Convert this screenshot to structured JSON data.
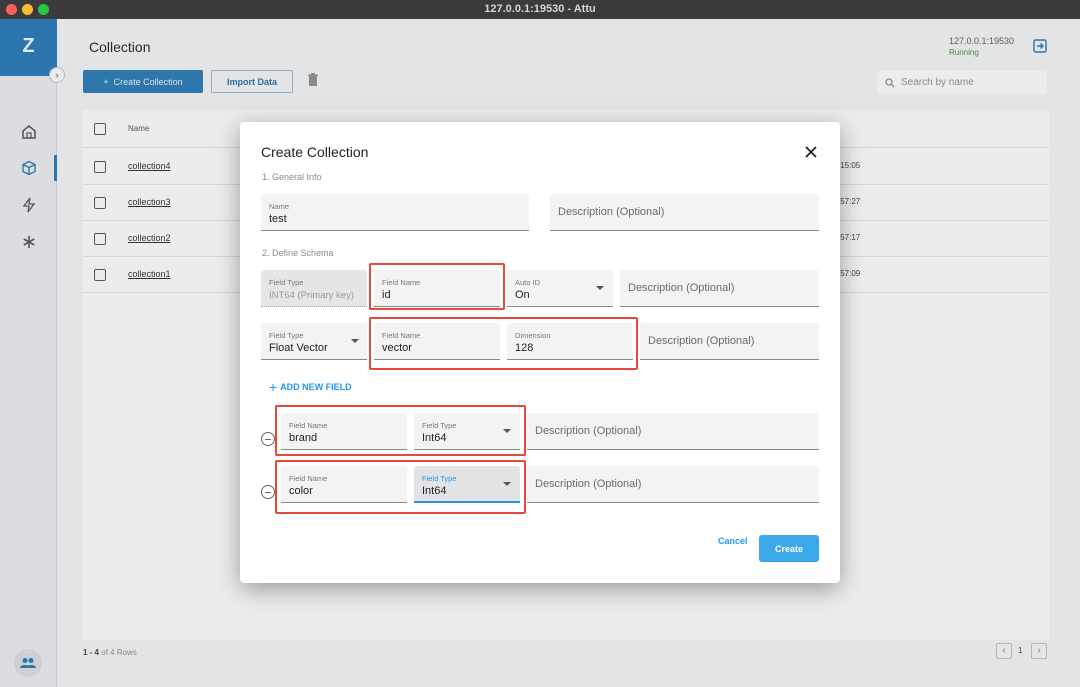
{
  "window": {
    "title": "127.0.0.1:19530 - Attu"
  },
  "sidebar": {
    "logo": "Z",
    "collapse_glyph": "›",
    "icons": [
      "home-icon",
      "cube-icon",
      "lightning-icon",
      "asterisk-icon"
    ],
    "active_item": "collections"
  },
  "header": {
    "title": "Collection",
    "server_address": "127.0.0.1:19530",
    "server_status": "Running"
  },
  "toolbar": {
    "create_label": "Create Collection",
    "import_label": "Import Data",
    "search_placeholder": "Search by name"
  },
  "table": {
    "name_header": "Name",
    "rows": [
      {
        "name": "collection4",
        "time": ":15:05"
      },
      {
        "name": "collection3",
        "time": ":57:27"
      },
      {
        "name": "collection2",
        "time": ":57:17"
      },
      {
        "name": "collection1",
        "time": ":57:09"
      }
    ]
  },
  "pagination": {
    "range": "1 - 4",
    "total": "of 4 Rows",
    "page": "1"
  },
  "modal": {
    "title": "Create Collection",
    "section1": "1. General Info",
    "name_label": "Name",
    "name_value": "test",
    "description_placeholder": "Description (Optional)",
    "section2": "2. Define Schema",
    "primary": {
      "type_label": "Field Type",
      "type_value": "INT64 (Primary key)",
      "name_label": "Field Name",
      "name_value": "id",
      "autoid_label": "Auto ID",
      "autoid_value": "On"
    },
    "vector": {
      "type_label": "Field Type",
      "type_value": "Float Vector",
      "name_label": "Field Name",
      "name_value": "vector",
      "dim_label": "Dimension",
      "dim_value": "128"
    },
    "add_field_label": "ADD NEW FIELD",
    "extra_fields": [
      {
        "name_label": "Field Name",
        "name_value": "brand",
        "type_label": "Field Type",
        "type_value": "Int64"
      },
      {
        "name_label": "Field Name",
        "name_value": "color",
        "type_label": "Field Type",
        "type_value": "Int64"
      }
    ],
    "cancel_label": "Cancel",
    "create_label": "Create"
  },
  "colors": {
    "accent": "#2196f3",
    "highlight": "#e34a3b",
    "primary_button": "#3ba8ec"
  }
}
